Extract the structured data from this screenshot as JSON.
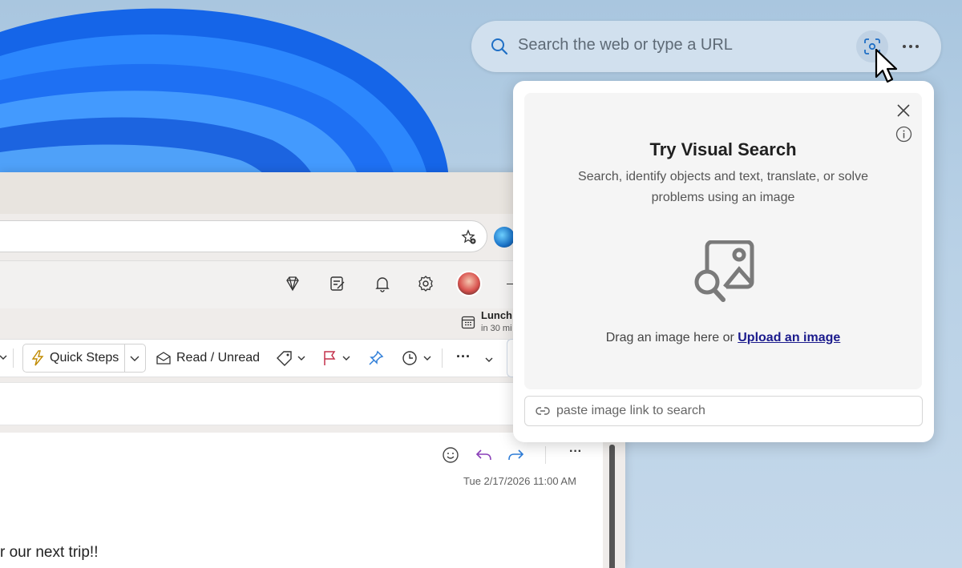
{
  "search": {
    "placeholder": "Search the web or type a URL"
  },
  "visual_search": {
    "title": "Try Visual Search",
    "description": "Search, identify objects and text, translate, or solve problems using an image",
    "drag_prompt": "Drag an image here or ",
    "upload_link": "Upload an image",
    "link_placeholder": "paste image link to search"
  },
  "outlook": {
    "reminder": {
      "title": "Lunch",
      "subtitle": "in 30 mi"
    },
    "ribbon": {
      "quick_steps": "Quick Steps",
      "read_unread": "Read / Unread",
      "more": "···"
    },
    "message": {
      "date": "Tue 2/17/2026 11:00 AM",
      "body": "r our next trip!!",
      "more": "···"
    }
  },
  "colors": {
    "accent_blue": "#0f6cbd",
    "flag_red": "#c4314b",
    "reply_purple": "#8a3fb8",
    "link": "#1a1a8c"
  },
  "icons": [
    "search-icon",
    "visual-search-icon",
    "more-icon",
    "close-icon",
    "info-icon",
    "image-search-icon",
    "link-icon",
    "favorite-icon",
    "copilot-icon",
    "premium-icon",
    "notes-icon",
    "bell-icon",
    "settings-icon",
    "calendar-icon",
    "lightning-icon",
    "envelope-icon",
    "tag-icon",
    "flag-icon",
    "pin-icon",
    "clock-icon",
    "emoji-icon",
    "reply-icon",
    "forward-icon",
    "chevron-down-icon"
  ]
}
